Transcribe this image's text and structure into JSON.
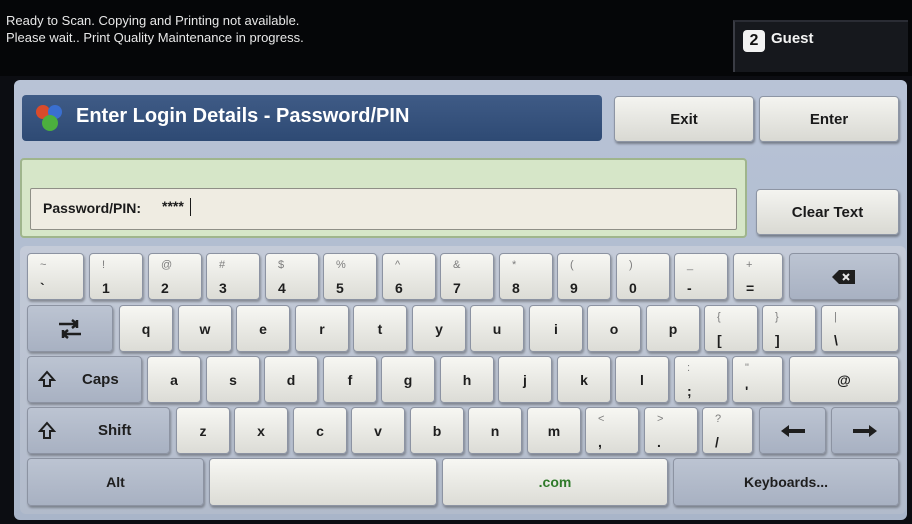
{
  "status": {
    "line1": "Ready to Scan.  Copying and Printing not available.",
    "line2": "Please wait.. Print Quality Maintenance in progress."
  },
  "user": {
    "icon": "user-badge-icon",
    "label": "Guest"
  },
  "header": {
    "title": "Enter Login Details - Password/PIN",
    "exit_label": "Exit",
    "enter_label": "Enter"
  },
  "password_field": {
    "label": "Password/PIN:",
    "value": "****"
  },
  "clear_text_label": "Clear Text",
  "keys": {
    "backtick": {
      "secondary": "~",
      "primary": "`"
    },
    "n1": {
      "secondary": "!",
      "primary": "1"
    },
    "n2": {
      "secondary": "@",
      "primary": "2"
    },
    "n3": {
      "secondary": "#",
      "primary": "3"
    },
    "n4": {
      "secondary": "$",
      "primary": "4"
    },
    "n5": {
      "secondary": "%",
      "primary": "5"
    },
    "n6": {
      "secondary": "^",
      "primary": "6"
    },
    "n7": {
      "secondary": "&",
      "primary": "7"
    },
    "n8": {
      "secondary": "*",
      "primary": "8"
    },
    "n9": {
      "secondary": "(",
      "primary": "9"
    },
    "n0": {
      "secondary": ")",
      "primary": "0"
    },
    "minus": {
      "secondary": "_",
      "primary": "-"
    },
    "equals": {
      "secondary": "+",
      "primary": "="
    },
    "q": "q",
    "w": "w",
    "e": "e",
    "r": "r",
    "t": "t",
    "y": "y",
    "u": "u",
    "i": "i",
    "o": "o",
    "p": "p",
    "lbracket": {
      "secondary": "{",
      "primary": "["
    },
    "rbracket": {
      "secondary": "}",
      "primary": "]"
    },
    "backslash": {
      "secondary": "|",
      "primary": "\\"
    },
    "caps_label": "Caps",
    "a": "a",
    "s": "s",
    "d": "d",
    "f": "f",
    "g": "g",
    "h": "h",
    "j": "j",
    "k": "k",
    "l": "l",
    "semicolon": {
      "secondary": ":",
      "primary": ";"
    },
    "quote": {
      "secondary": "\"",
      "primary": "'"
    },
    "at": "@",
    "shift_label": "Shift",
    "z": "z",
    "x": "x",
    "c": "c",
    "v": "v",
    "b": "b",
    "n": "n",
    "m": "m",
    "comma": {
      "secondary": "<",
      "primary": ","
    },
    "period": {
      "secondary": ">",
      "primary": "."
    },
    "slash": {
      "secondary": "?",
      "primary": "/"
    },
    "alt_label": "Alt",
    "dotcom_label": ".com",
    "keyboards_label": "Keyboards..."
  },
  "icons": {
    "backspace": "backspace-icon",
    "tab": "tab-icon",
    "caps": "caps-lock-icon",
    "shift": "shift-icon",
    "left": "arrow-left-icon",
    "right": "arrow-right-icon"
  },
  "colors": {
    "title_bar": "#2e4a74",
    "entry_area": "#d6e6c8",
    "dotcom_text": "#2f7a2a"
  }
}
